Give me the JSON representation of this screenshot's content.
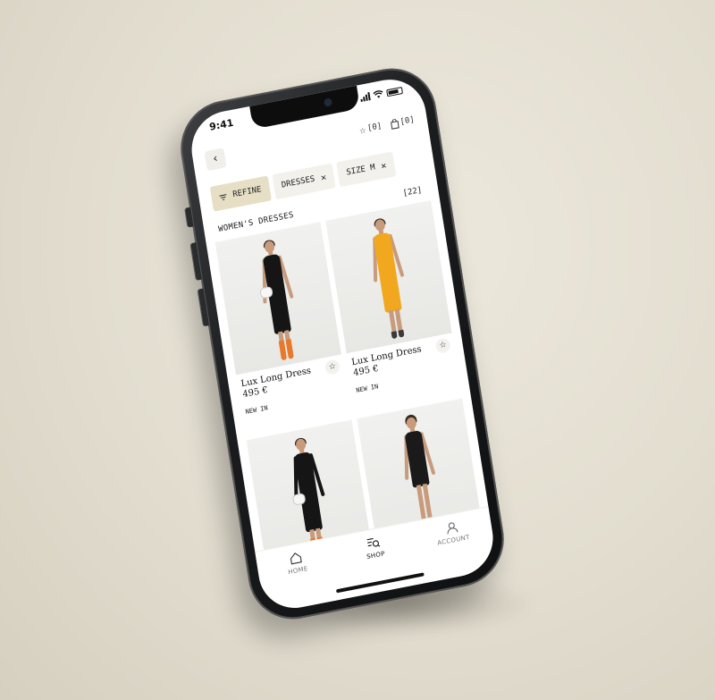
{
  "status_bar": {
    "time": "9:41"
  },
  "header": {
    "back_icon": "chevron-left-icon",
    "favorites": {
      "icon": "star-outline-icon",
      "count": "[0]"
    },
    "bag": {
      "icon": "shopping-bag-icon",
      "count": "[0]"
    }
  },
  "filters": {
    "refine_label": "REFINE",
    "chips": [
      {
        "label": "DRESSES"
      },
      {
        "label": "SIZE M"
      }
    ]
  },
  "section": {
    "title": "WOMEN'S DRESSES",
    "count": "[22]"
  },
  "products": [
    {
      "name": "Lux Long Dress",
      "price": "495 €",
      "badge": "NEW IN",
      "dress_color": "#151515",
      "boot_color": "#e8782a"
    },
    {
      "name": "Lux Long Dress",
      "price": "495 €",
      "badge": "NEW IN",
      "dress_color": "#f2a81e",
      "boot_color": "#3a3a3a"
    },
    {
      "dress_color": "#151515",
      "boot_color": "#e8782a"
    },
    {
      "dress_color": "#1a1a1a",
      "boot_color": "#c79b7c"
    }
  ],
  "tabbar": {
    "items": [
      {
        "label": "HOME",
        "icon": "home-icon"
      },
      {
        "label": "SHOP",
        "icon": "shop-search-icon",
        "active": true
      },
      {
        "label": "ACCOUNT",
        "icon": "user-icon"
      }
    ]
  },
  "colors": {
    "refine_chip": "#e6dfc6",
    "chip": "#f2f1ec",
    "background": "#e2ddcf"
  }
}
